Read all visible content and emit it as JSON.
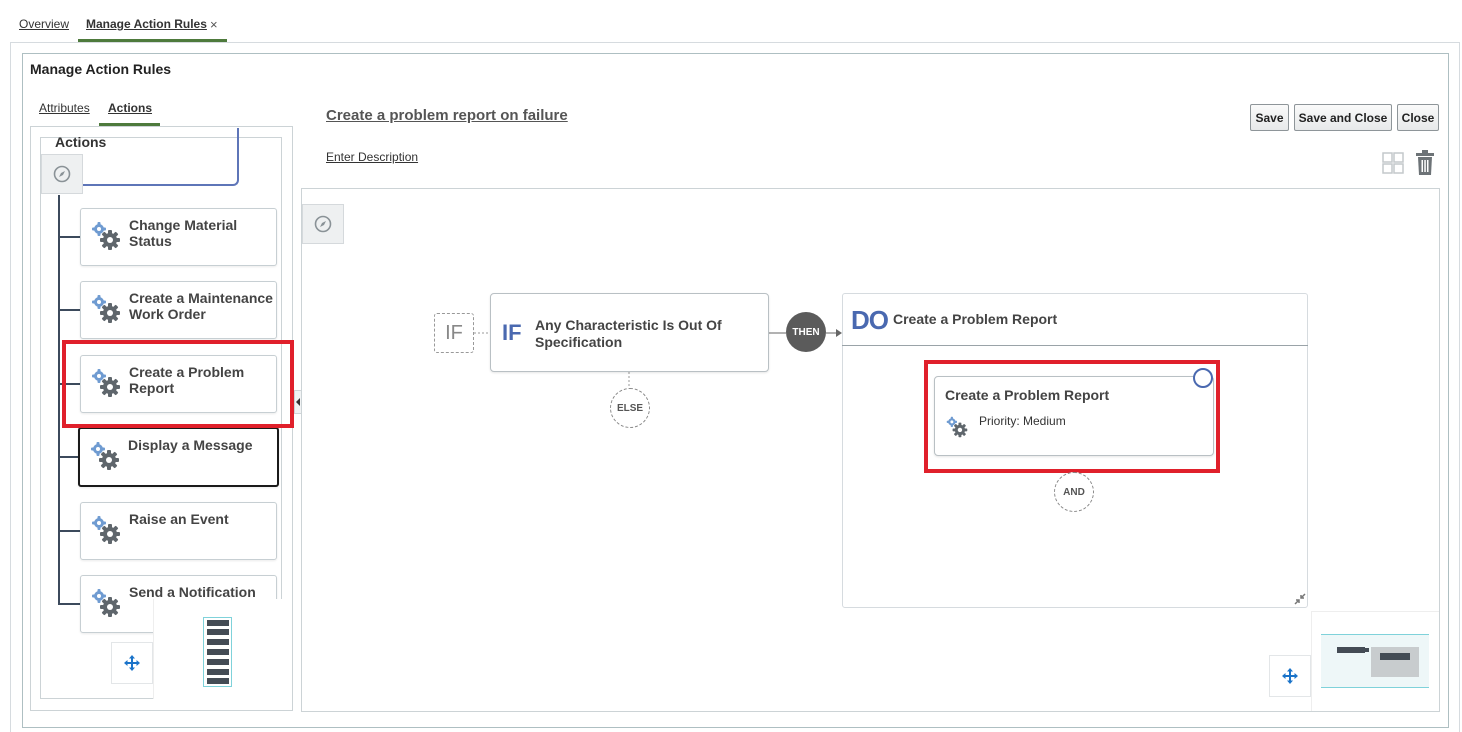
{
  "top_tabs": {
    "overview": "Overview",
    "manage": "Manage Action Rules",
    "close_glyph": "×"
  },
  "panel": {
    "title": "Manage Action Rules"
  },
  "left": {
    "tabs": {
      "attributes": "Attributes",
      "actions": "Actions"
    },
    "tree_root": "Actions",
    "items": [
      {
        "label": "Change Material Status"
      },
      {
        "label": "Create a Maintenance Work Order"
      },
      {
        "label": "Create a Problem Report"
      },
      {
        "label": "Display a Message"
      },
      {
        "label": "Raise an Event"
      },
      {
        "label": "Send a Notification"
      }
    ]
  },
  "rule": {
    "name": "Create a problem report on failure",
    "description_link": "Enter Description"
  },
  "buttons": {
    "save": "Save",
    "save_close": "Save and Close",
    "close": "Close"
  },
  "canvas": {
    "if_small": "IF",
    "if_big": "IF",
    "if_text": "Any Characteristic Is Out Of Specification",
    "then": "THEN",
    "else": "ELSE",
    "do_big": "DO",
    "do_text": "Create a Problem Report",
    "action": {
      "title": "Create a Problem Report",
      "detail": "Priority: Medium"
    },
    "and": "AND"
  },
  "colors": {
    "accent": "#4a69b0",
    "tab_underline": "#4e7a3c",
    "highlight": "#e0202b"
  }
}
